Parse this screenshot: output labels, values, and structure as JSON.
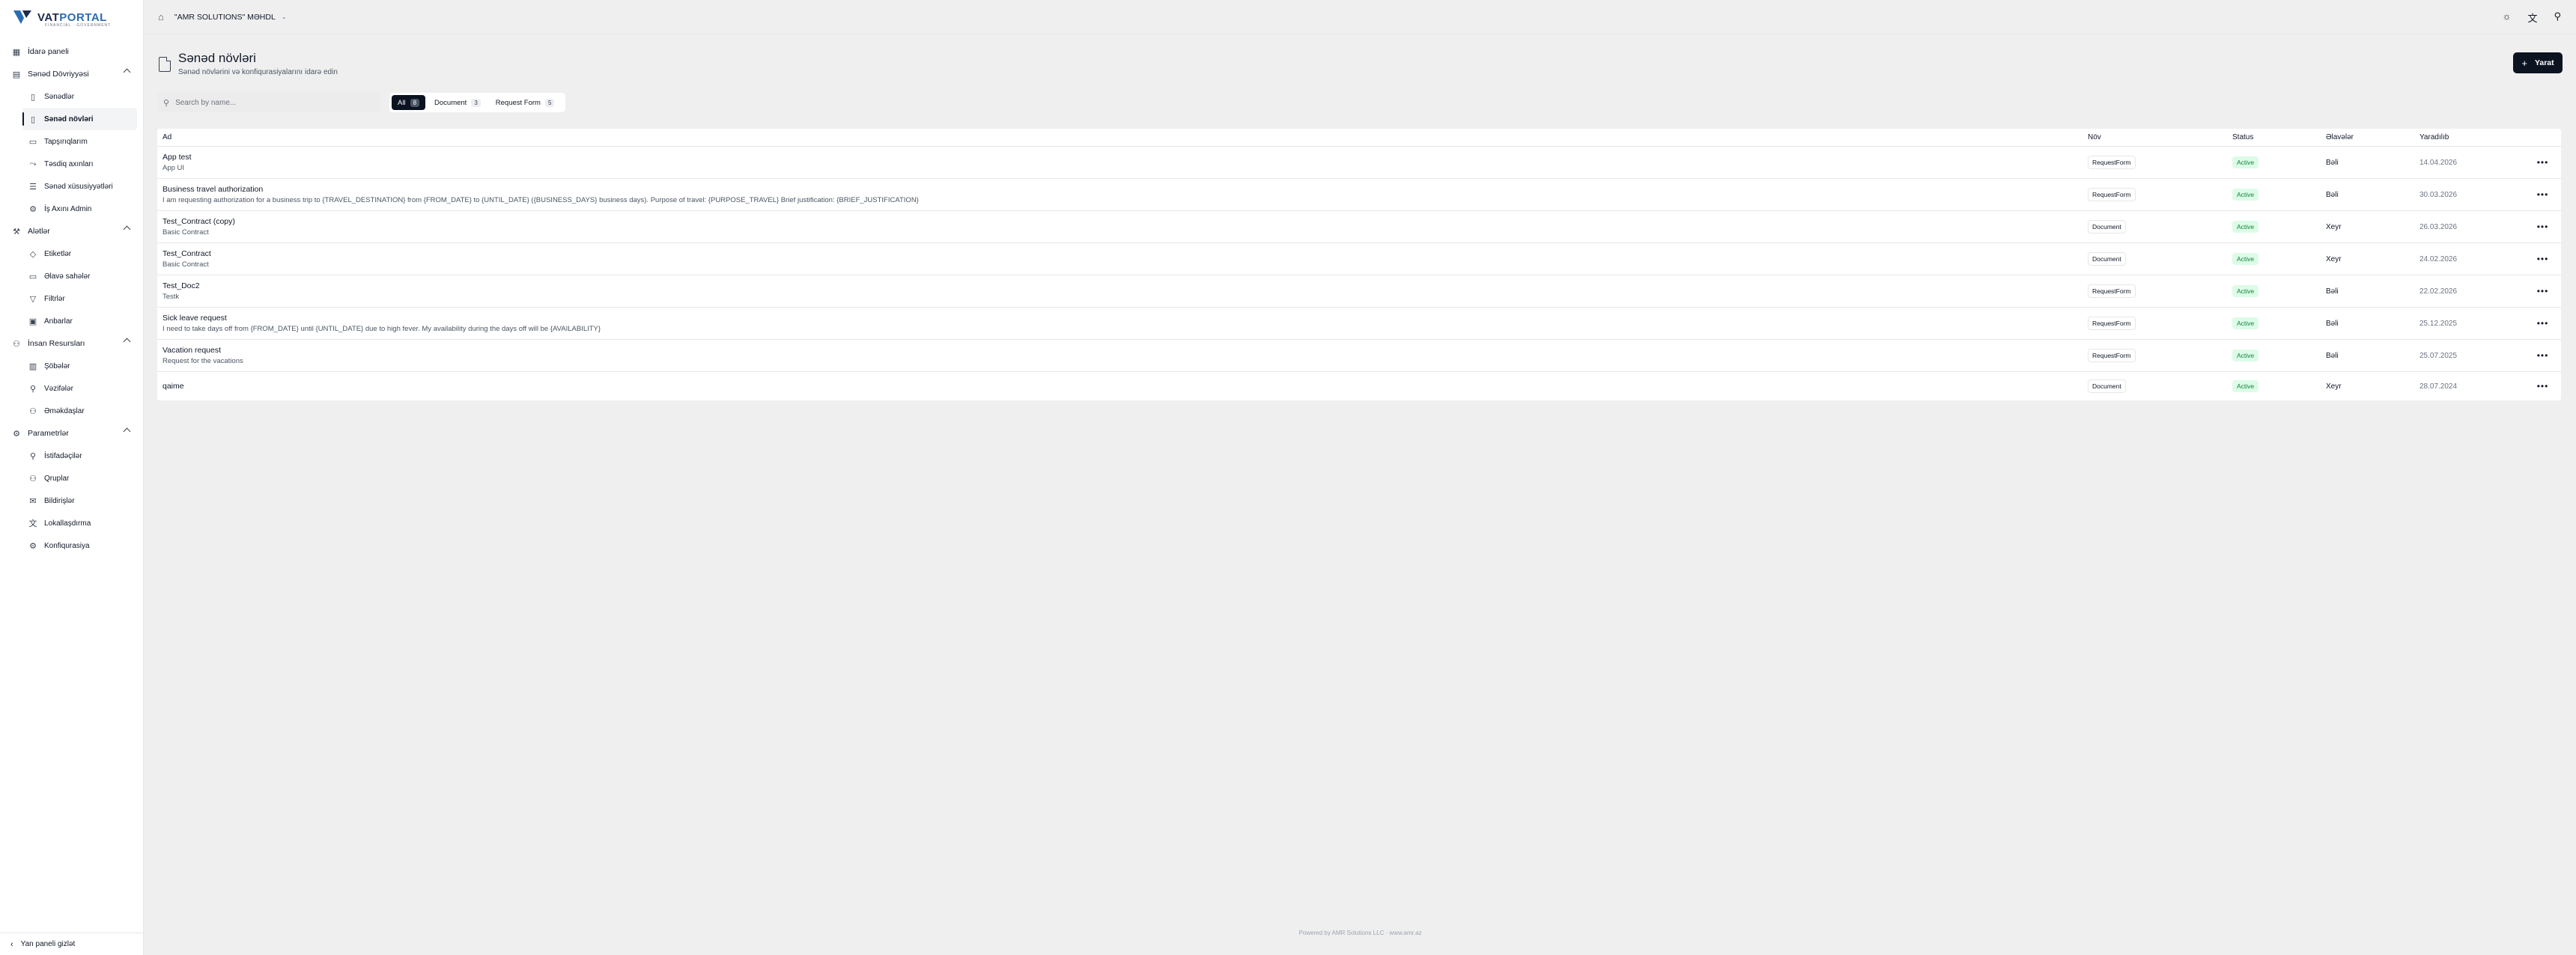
{
  "brand": {
    "name_a": "VAT",
    "name_b": "PORTAL",
    "tagline": "FINANCIAL · GOVERNMENT"
  },
  "sidebar": {
    "dashboard": "İdarə paneli",
    "doc_flow": {
      "label": "Sənəd Dövriyyəsi",
      "items": [
        "Sənədlər",
        "Sənəd növləri",
        "Tapşırıqlarım",
        "Təsdiq axınları",
        "Sənəd xüsusiyyətləri",
        "İş Axını Admin"
      ]
    },
    "tools": {
      "label": "Alətlər",
      "items": [
        "Etiketlər",
        "Əlavə sahələr",
        "Filtrlər",
        "Anbarlar"
      ]
    },
    "hr": {
      "label": "İnsan Resursları",
      "items": [
        "Şöbələr",
        "Vəzifələr",
        "Əməkdaşlar"
      ]
    },
    "settings": {
      "label": "Parametrlər",
      "items": [
        "İstifadəçilər",
        "Qruplar",
        "Bildirişlər",
        "Lokallaşdırma",
        "Konfiqurasiya"
      ]
    },
    "collapse": "Yan paneli gizlət"
  },
  "topbar": {
    "company": "\"AMR SOLUTIONS\" MƏHDL"
  },
  "header": {
    "title": "Sənəd növləri",
    "subtitle": "Sənəd növlərini və konfiqurasiyalarını idarə edin",
    "create": "Yarat"
  },
  "filters": {
    "search_placeholder": "Search by name...",
    "tabs": [
      {
        "label": "All",
        "count": "8"
      },
      {
        "label": "Document",
        "count": "3"
      },
      {
        "label": "Request Form",
        "count": "5"
      }
    ]
  },
  "table": {
    "columns": {
      "name": "Ad",
      "type": "Növ",
      "status": "Status",
      "favorite": "Əlavələr",
      "created": "Yaradılıb"
    },
    "rows": [
      {
        "title": "App test",
        "desc": "App UI",
        "type": "RequestForm",
        "status": "Active",
        "fav": "Bəli",
        "date": "14.04.2026"
      },
      {
        "title": "Business travel authorization",
        "desc": "I am requesting authorization for a business trip to {TRAVEL_DESTINATION} from {FROM_DATE} to {UNTIL_DATE} ({BUSINESS_DAYS} business days). Purpose of travel: {PURPOSE_TRAVEL} Brief justification: {BRIEF_JUSTIFICATION}",
        "type": "RequestForm",
        "status": "Active",
        "fav": "Bəli",
        "date": "30.03.2026"
      },
      {
        "title": "Test_Contract (copy)",
        "desc": "Basic Contract",
        "type": "Document",
        "status": "Active",
        "fav": "Xeyr",
        "date": "26.03.2026"
      },
      {
        "title": "Test_Contract",
        "desc": "Basic Contract",
        "type": "Document",
        "status": "Active",
        "fav": "Xeyr",
        "date": "24.02.2026"
      },
      {
        "title": "Test_Doc2",
        "desc": "Testk",
        "type": "RequestForm",
        "status": "Active",
        "fav": "Bəli",
        "date": "22.02.2026"
      },
      {
        "title": "Sick leave request",
        "desc": "I need to take days off from {FROM_DATE} until {UNTIL_DATE} due to high fever. My availability during the days off will be {AVAILABILITY}",
        "type": "RequestForm",
        "status": "Active",
        "fav": "Bəli",
        "date": "25.12.2025"
      },
      {
        "title": "Vacation request",
        "desc": "Request for the vacations",
        "type": "RequestForm",
        "status": "Active",
        "fav": "Bəli",
        "date": "25.07.2025"
      },
      {
        "title": "qaime",
        "desc": "",
        "type": "Document",
        "status": "Active",
        "fav": "Xeyr",
        "date": "28.07.2024"
      }
    ]
  },
  "footer": "Powered by AMR Solutions LLC · www.amr.az"
}
